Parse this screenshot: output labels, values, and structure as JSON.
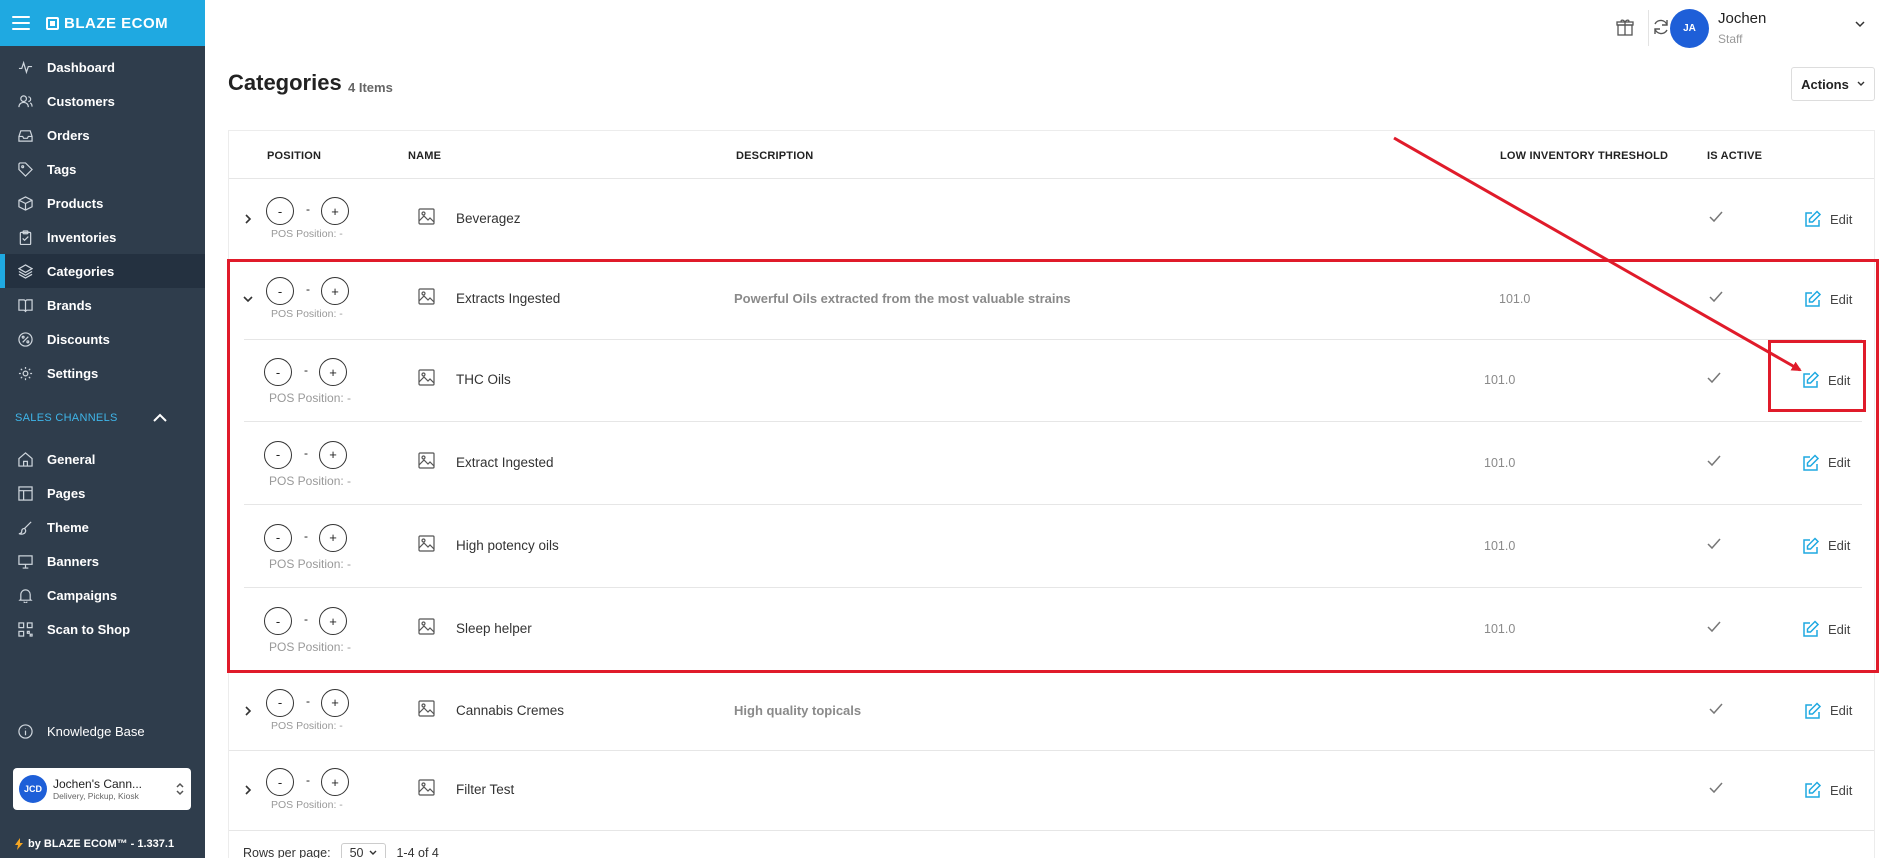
{
  "brand": {
    "name": "BLAZE ECOM"
  },
  "sidebar": {
    "items": [
      {
        "label": "Dashboard",
        "icon": "pulse-icon"
      },
      {
        "label": "Customers",
        "icon": "users-icon"
      },
      {
        "label": "Orders",
        "icon": "inbox-icon"
      },
      {
        "label": "Tags",
        "icon": "tag-icon"
      },
      {
        "label": "Products",
        "icon": "box-icon"
      },
      {
        "label": "Inventories",
        "icon": "clipboard-icon"
      },
      {
        "label": "Categories",
        "icon": "layers-icon",
        "active": true
      },
      {
        "label": "Brands",
        "icon": "book-icon"
      },
      {
        "label": "Discounts",
        "icon": "discount-icon"
      },
      {
        "label": "Settings",
        "icon": "gear-icon"
      }
    ],
    "sales_channels_label": "SALES CHANNELS",
    "channel_items": [
      {
        "label": "General",
        "icon": "home-icon"
      },
      {
        "label": "Pages",
        "icon": "layout-icon"
      },
      {
        "label": "Theme",
        "icon": "brush-icon"
      },
      {
        "label": "Banners",
        "icon": "monitor-icon"
      },
      {
        "label": "Campaigns",
        "icon": "bell-icon"
      },
      {
        "label": "Scan to Shop",
        "icon": "qr-icon"
      }
    ],
    "knowledge_base": "Knowledge Base",
    "store": {
      "initials": "JCD",
      "name": "Jochen's Cann...",
      "sub": "Delivery, Pickup, Kiosk"
    },
    "version": "by BLAZE ECOM™ - 1.337.1"
  },
  "user": {
    "initials": "JA",
    "name": "Jochen",
    "role": "Staff"
  },
  "page": {
    "title": "Categories",
    "count": "4 Items",
    "actions_label": "Actions"
  },
  "table": {
    "headers": {
      "position": "POSITION",
      "name": "NAME",
      "description": "DESCRIPTION",
      "threshold": "LOW INVENTORY THRESHOLD",
      "active": "IS ACTIVE"
    },
    "pos_minus": "-",
    "pos_plus": "+",
    "pos_value": "-",
    "pos_label": "POS Position: -",
    "edit_label": "Edit",
    "rows": [
      {
        "name": "Beveragez",
        "description": "",
        "threshold": "",
        "expanded": false,
        "level": 0
      },
      {
        "name": "Extracts Ingested",
        "description": "Powerful Oils extracted from the most valuable strains",
        "threshold": "101.0",
        "expanded": true,
        "level": 0
      },
      {
        "name": "THC Oils",
        "description": "",
        "threshold": "101.0",
        "level": 1
      },
      {
        "name": "Extract Ingested",
        "description": "",
        "threshold": "101.0",
        "level": 1
      },
      {
        "name": "High potency oils",
        "description": "",
        "threshold": "101.0",
        "level": 1
      },
      {
        "name": "Sleep helper",
        "description": "",
        "threshold": "101.0",
        "level": 1
      },
      {
        "name": "Cannabis Cremes",
        "description": "High quality topicals",
        "threshold": "",
        "expanded": false,
        "level": 0
      },
      {
        "name": "Filter Test",
        "description": "",
        "threshold": "",
        "expanded": false,
        "level": 0
      }
    ]
  },
  "pager": {
    "rows_label": "Rows per page:",
    "rows_value": "50",
    "range": "1-4 of 4"
  },
  "colors": {
    "accent": "#1fa9e1",
    "sidebar": "#2f3d4c",
    "annotation": "#e01b2a",
    "avatar": "#1e5fd8"
  }
}
